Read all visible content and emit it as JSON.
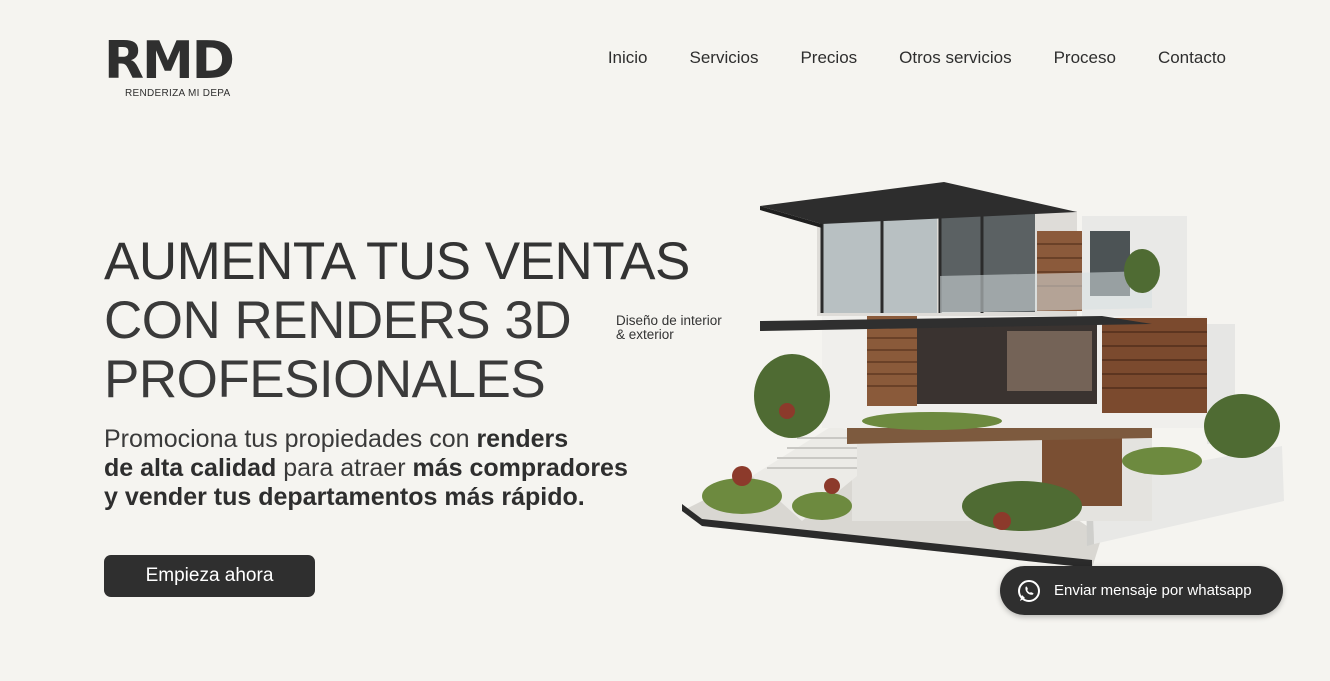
{
  "brand": {
    "logo_text": "RMD",
    "logo_subtitle": "RENDERIZA MI DEPA"
  },
  "nav": {
    "items": [
      "Inicio",
      "Servicios",
      "Precios",
      "Otros servicios",
      "Proceso",
      "Contacto"
    ]
  },
  "hero": {
    "title_line1": "AUMENTA TUS VENTAS",
    "title_line2": "CON RENDERS 3D",
    "title_line3": "PROFESIONALES",
    "tagline_line1": "Diseño de interior",
    "tagline_line2": "& exterior",
    "subtitle": {
      "p1": "Promociona tus propiedades con ",
      "b1": "renders",
      "b2": "de alta calidad",
      "p2": " para atraer ",
      "b3": "más compradores",
      "b4": "y vender tus departamentos más rápido."
    },
    "cta_label": "Empieza ahora",
    "image_icon": "modern-house-render"
  },
  "whatsapp": {
    "label": "Enviar mensaje por whatsapp",
    "icon": "whatsapp-icon"
  }
}
